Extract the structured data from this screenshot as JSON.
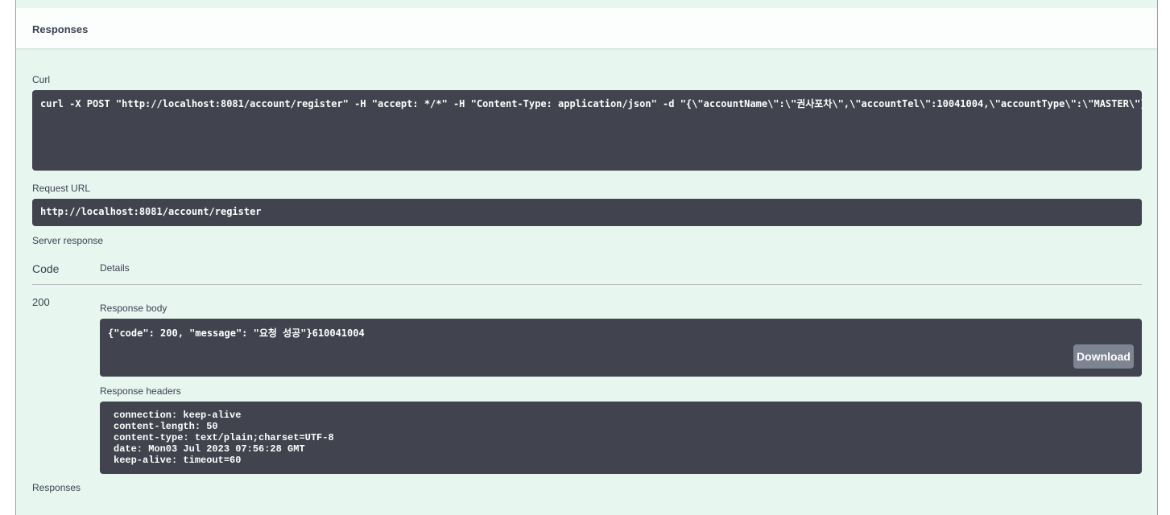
{
  "responses_header": "Responses",
  "curl": {
    "label": "Curl",
    "command": "curl -X POST \"http://localhost:8081/account/register\" -H \"accept: */*\" -H \"Content-Type: application/json\" -d \"{\\\"accountName\\\":\\\"권사포차\\\",\\\"accountTel\\\":10041004,\\\"accountType\\\":\\\"MASTER\\\"}\""
  },
  "request_url": {
    "label": "Request URL",
    "value": "http://localhost:8081/account/register"
  },
  "server_response": {
    "label": "Server response",
    "code_header": "Code",
    "details_header": "Details",
    "code": "200",
    "body_label": "Response body",
    "body": "{\"code\": 200, \"message\": \"요청 성공\"}610041004",
    "download_label": "Download",
    "headers_label": "Response headers",
    "headers": [
      "connection: keep-alive",
      "content-length: 50",
      "content-type: text/plain;charset=UTF-8",
      "date: Mon03 Jul 2023 07:56:28 GMT",
      "keep-alive: timeout=60"
    ]
  },
  "responses_footer_label": "Responses",
  "colors": {
    "opblock_bg": "#e8f6f0",
    "opblock_border": "#49cc90",
    "code_bg": "#41444e",
    "download_bg": "#7d8492"
  }
}
